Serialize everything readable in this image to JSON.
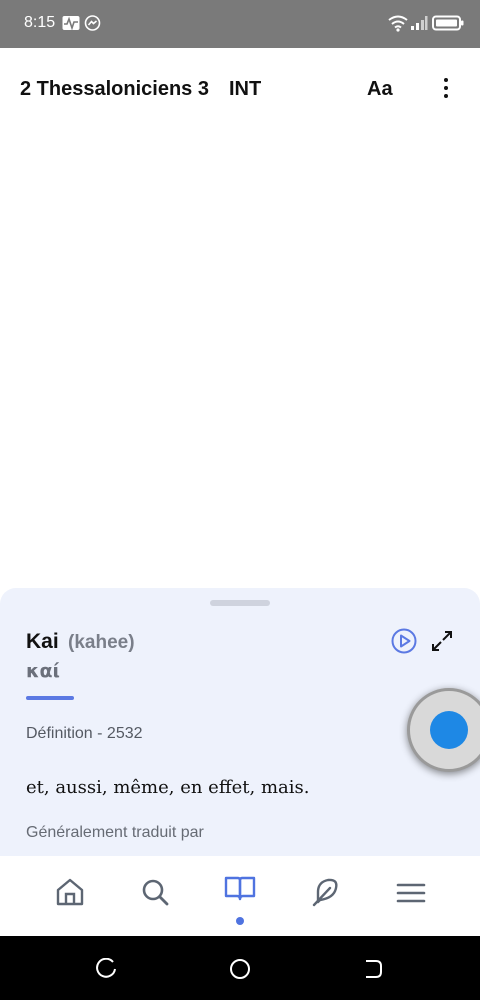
{
  "status_bar": {
    "time": "8:15",
    "left_icons": [
      "activity-icon",
      "messenger-icon"
    ],
    "right_icons": [
      "wifi-icon",
      "signal-icon",
      "battery-icon"
    ]
  },
  "header": {
    "title": "2 Thessaloniciens 3",
    "translation": "INT",
    "font_size_label": "Aa",
    "menu_icon": "more-vertical-icon"
  },
  "sheet": {
    "word": "Kai",
    "pronunciation": "(kahee)",
    "greek": "καί",
    "definition_label": "Définition - 2532",
    "definition_text": "et, aussi, même, en effet, mais.",
    "usage_label": "Généralement traduit par",
    "play_icon": "play-circle-icon",
    "expand_icon": "expand-icon"
  },
  "bottom_nav": {
    "items": [
      {
        "icon": "home-icon"
      },
      {
        "icon": "search-icon"
      },
      {
        "icon": "book-icon",
        "active": true
      },
      {
        "icon": "feather-icon"
      },
      {
        "icon": "menu-icon"
      }
    ]
  },
  "system_nav": {
    "items": [
      "recents-icon",
      "home-circle-icon",
      "back-icon"
    ]
  },
  "colors": {
    "accent": "#5b79e3",
    "sheet_bg": "#eef2fc",
    "fab": "#1e88e5",
    "status_bar": "#7a7a7a"
  }
}
